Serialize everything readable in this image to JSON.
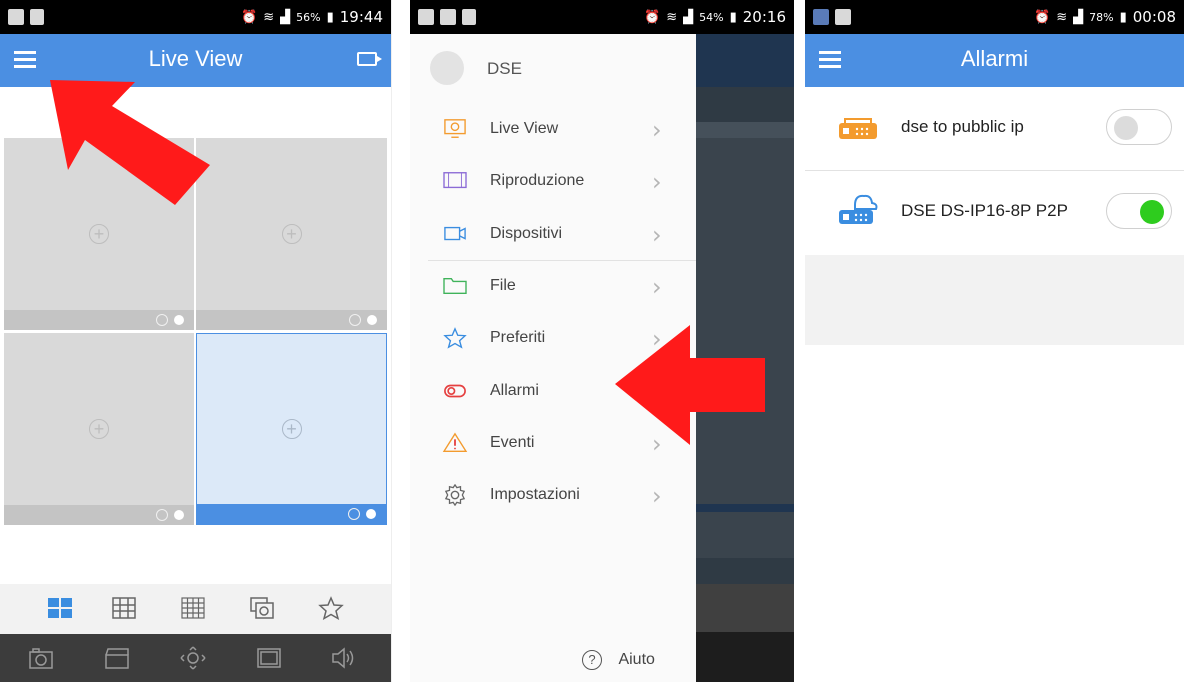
{
  "screen1": {
    "status": {
      "battery": "56%",
      "time": "19:44"
    },
    "title": "Live View",
    "icons": {
      "menu": "hamburger-icon",
      "camera": "video-camera-icon",
      "add": "plus-circle-icon",
      "toolbar": [
        "grid-2x2-icon",
        "grid-3x3-icon",
        "grid-4x4-icon",
        "multi-screen-icon",
        "star-icon"
      ],
      "bottombar": [
        "camera-icon",
        "clapperboard-icon",
        "ptz-icon",
        "image-icon",
        "speaker-icon"
      ]
    },
    "colors": {
      "accent": "#4b8fe2",
      "selected_cell": "#dce9f8"
    }
  },
  "screen2": {
    "status": {
      "battery": "54%",
      "time": "20:16"
    },
    "user": "DSE",
    "menu": [
      {
        "label": "Live View",
        "icon": "monitor-icon"
      },
      {
        "label": "Riproduzione",
        "icon": "filmstrip-icon"
      },
      {
        "label": "Dispositivi",
        "icon": "video-camera-icon"
      },
      {
        "label": "File",
        "icon": "folder-icon"
      },
      {
        "label": "Preferiti",
        "icon": "star-icon"
      },
      {
        "label": "Allarmi",
        "icon": "alarm-toggle-icon"
      },
      {
        "label": "Eventi",
        "icon": "warning-icon"
      },
      {
        "label": "Impostazioni",
        "icon": "gear-icon"
      }
    ],
    "help": "Aiuto"
  },
  "screen3": {
    "status": {
      "battery": "78%",
      "time": "00:08"
    },
    "title": "Allarmi",
    "devices": [
      {
        "name": "dse to pubblic ip",
        "enabled": false,
        "icon": "dvr-icon",
        "color": "#f39b2e"
      },
      {
        "name": "DSE DS-IP16-8P P2P",
        "enabled": true,
        "icon": "cloud-dvr-icon",
        "color": "#3a8de0"
      }
    ],
    "colors": {
      "toggle_on": "#2ecc1e",
      "toggle_off": "#dcdcdc"
    }
  }
}
